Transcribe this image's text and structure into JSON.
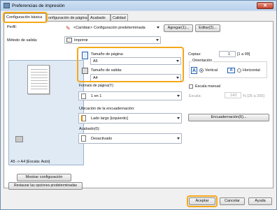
{
  "window": {
    "title": "Preferencias de impresión",
    "close_label": "✕"
  },
  "tabs": [
    "Configuración básica",
    "onfiguración de página",
    "Acabado",
    "Calidad"
  ],
  "profile": {
    "label": "Perfil:",
    "value": "<Cambiar> Configuración predeterminada",
    "add_button": "Agregar(1)...",
    "edit_button": "Editar(2)..."
  },
  "output": {
    "label": "Método de salida:",
    "value": "Imprimir"
  },
  "page_size": {
    "label": "Tamaño de página:",
    "value": "A5"
  },
  "output_size": {
    "label": "Tamaño de salida:",
    "value": "A4"
  },
  "copies": {
    "label": "Copias:",
    "value": "1",
    "range": "[1 a 99]"
  },
  "orientation": {
    "label": "Orientación",
    "vertical": "Vertical",
    "horizontal": "Horizontal",
    "selected": "Vertical"
  },
  "page_format": {
    "label": "Formato de página(Y):",
    "value": "1 en 1"
  },
  "manual_scale": {
    "label": "Escala manual",
    "scale_label": "Escala:",
    "value": "143",
    "range": "% [25 a 200]"
  },
  "binding": {
    "label": "Ubicación de la encuadernación:",
    "value": "Lado largo [izquierdo]",
    "button": "Encuadernación(6)..."
  },
  "finishing": {
    "label": "Acabado(0):",
    "value": "Desactivado"
  },
  "preview": {
    "caption": "A5 -> A4 [Escala: Auto]"
  },
  "buttons": {
    "show_config": "Mostrar configuración",
    "restore_defaults": "Restaurar las opciones predeterminadas",
    "accept": "Aceptar",
    "cancel": "Cancelar",
    "help": "Ayuda"
  },
  "colors": {
    "highlight": "#f4a818",
    "accent": "#1c5fb5"
  }
}
